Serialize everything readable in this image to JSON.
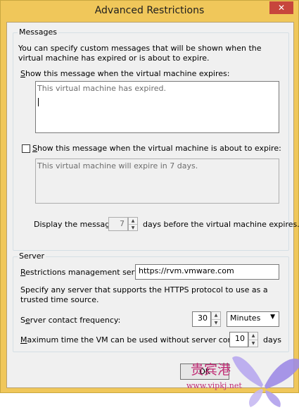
{
  "window": {
    "title": "Advanced Restrictions",
    "close_glyph": "✕"
  },
  "messages": {
    "group_title": "Messages",
    "description": "You can specify custom messages that will be shown when the virtual machine has expired or is about to expire.",
    "expire_label_key": "S",
    "expire_label_rest": "how this message when the virtual machine expires:",
    "expire_text": "This virtual machine has expired.",
    "about_label_key": "S",
    "about_label_rest": "how this message when the virtual machine is about to expire:",
    "about_checked": false,
    "about_text": "This virtual machine will expire in 7 days.",
    "display_prefix": "Display the message",
    "display_days": "7",
    "display_suffix": "days before the virtual machine expires."
  },
  "server": {
    "group_title": "Server",
    "mgmt_label_key": "R",
    "mgmt_label_rest": "estrictions management server:",
    "mgmt_value": "https://rvm.vmware.com",
    "hint": "Specify any server that supports the HTTPS protocol to use as a trusted time source.",
    "freq_label_pre": "S",
    "freq_label_key": "e",
    "freq_label_rest": "rver contact frequency:",
    "freq_value": "30",
    "freq_unit": "Minutes",
    "max_label_key": "M",
    "max_label_rest": "aximum time the VM can be used without server contact:",
    "max_value": "10",
    "max_unit": "days"
  },
  "buttons": {
    "ok": "OK"
  },
  "watermark": {
    "brand": "贵宾港",
    "url": "www.vipkj.net"
  },
  "colors": {
    "frame": "#f0c75a",
    "close_button": "#c7463c",
    "watermark": "#c12e76"
  }
}
